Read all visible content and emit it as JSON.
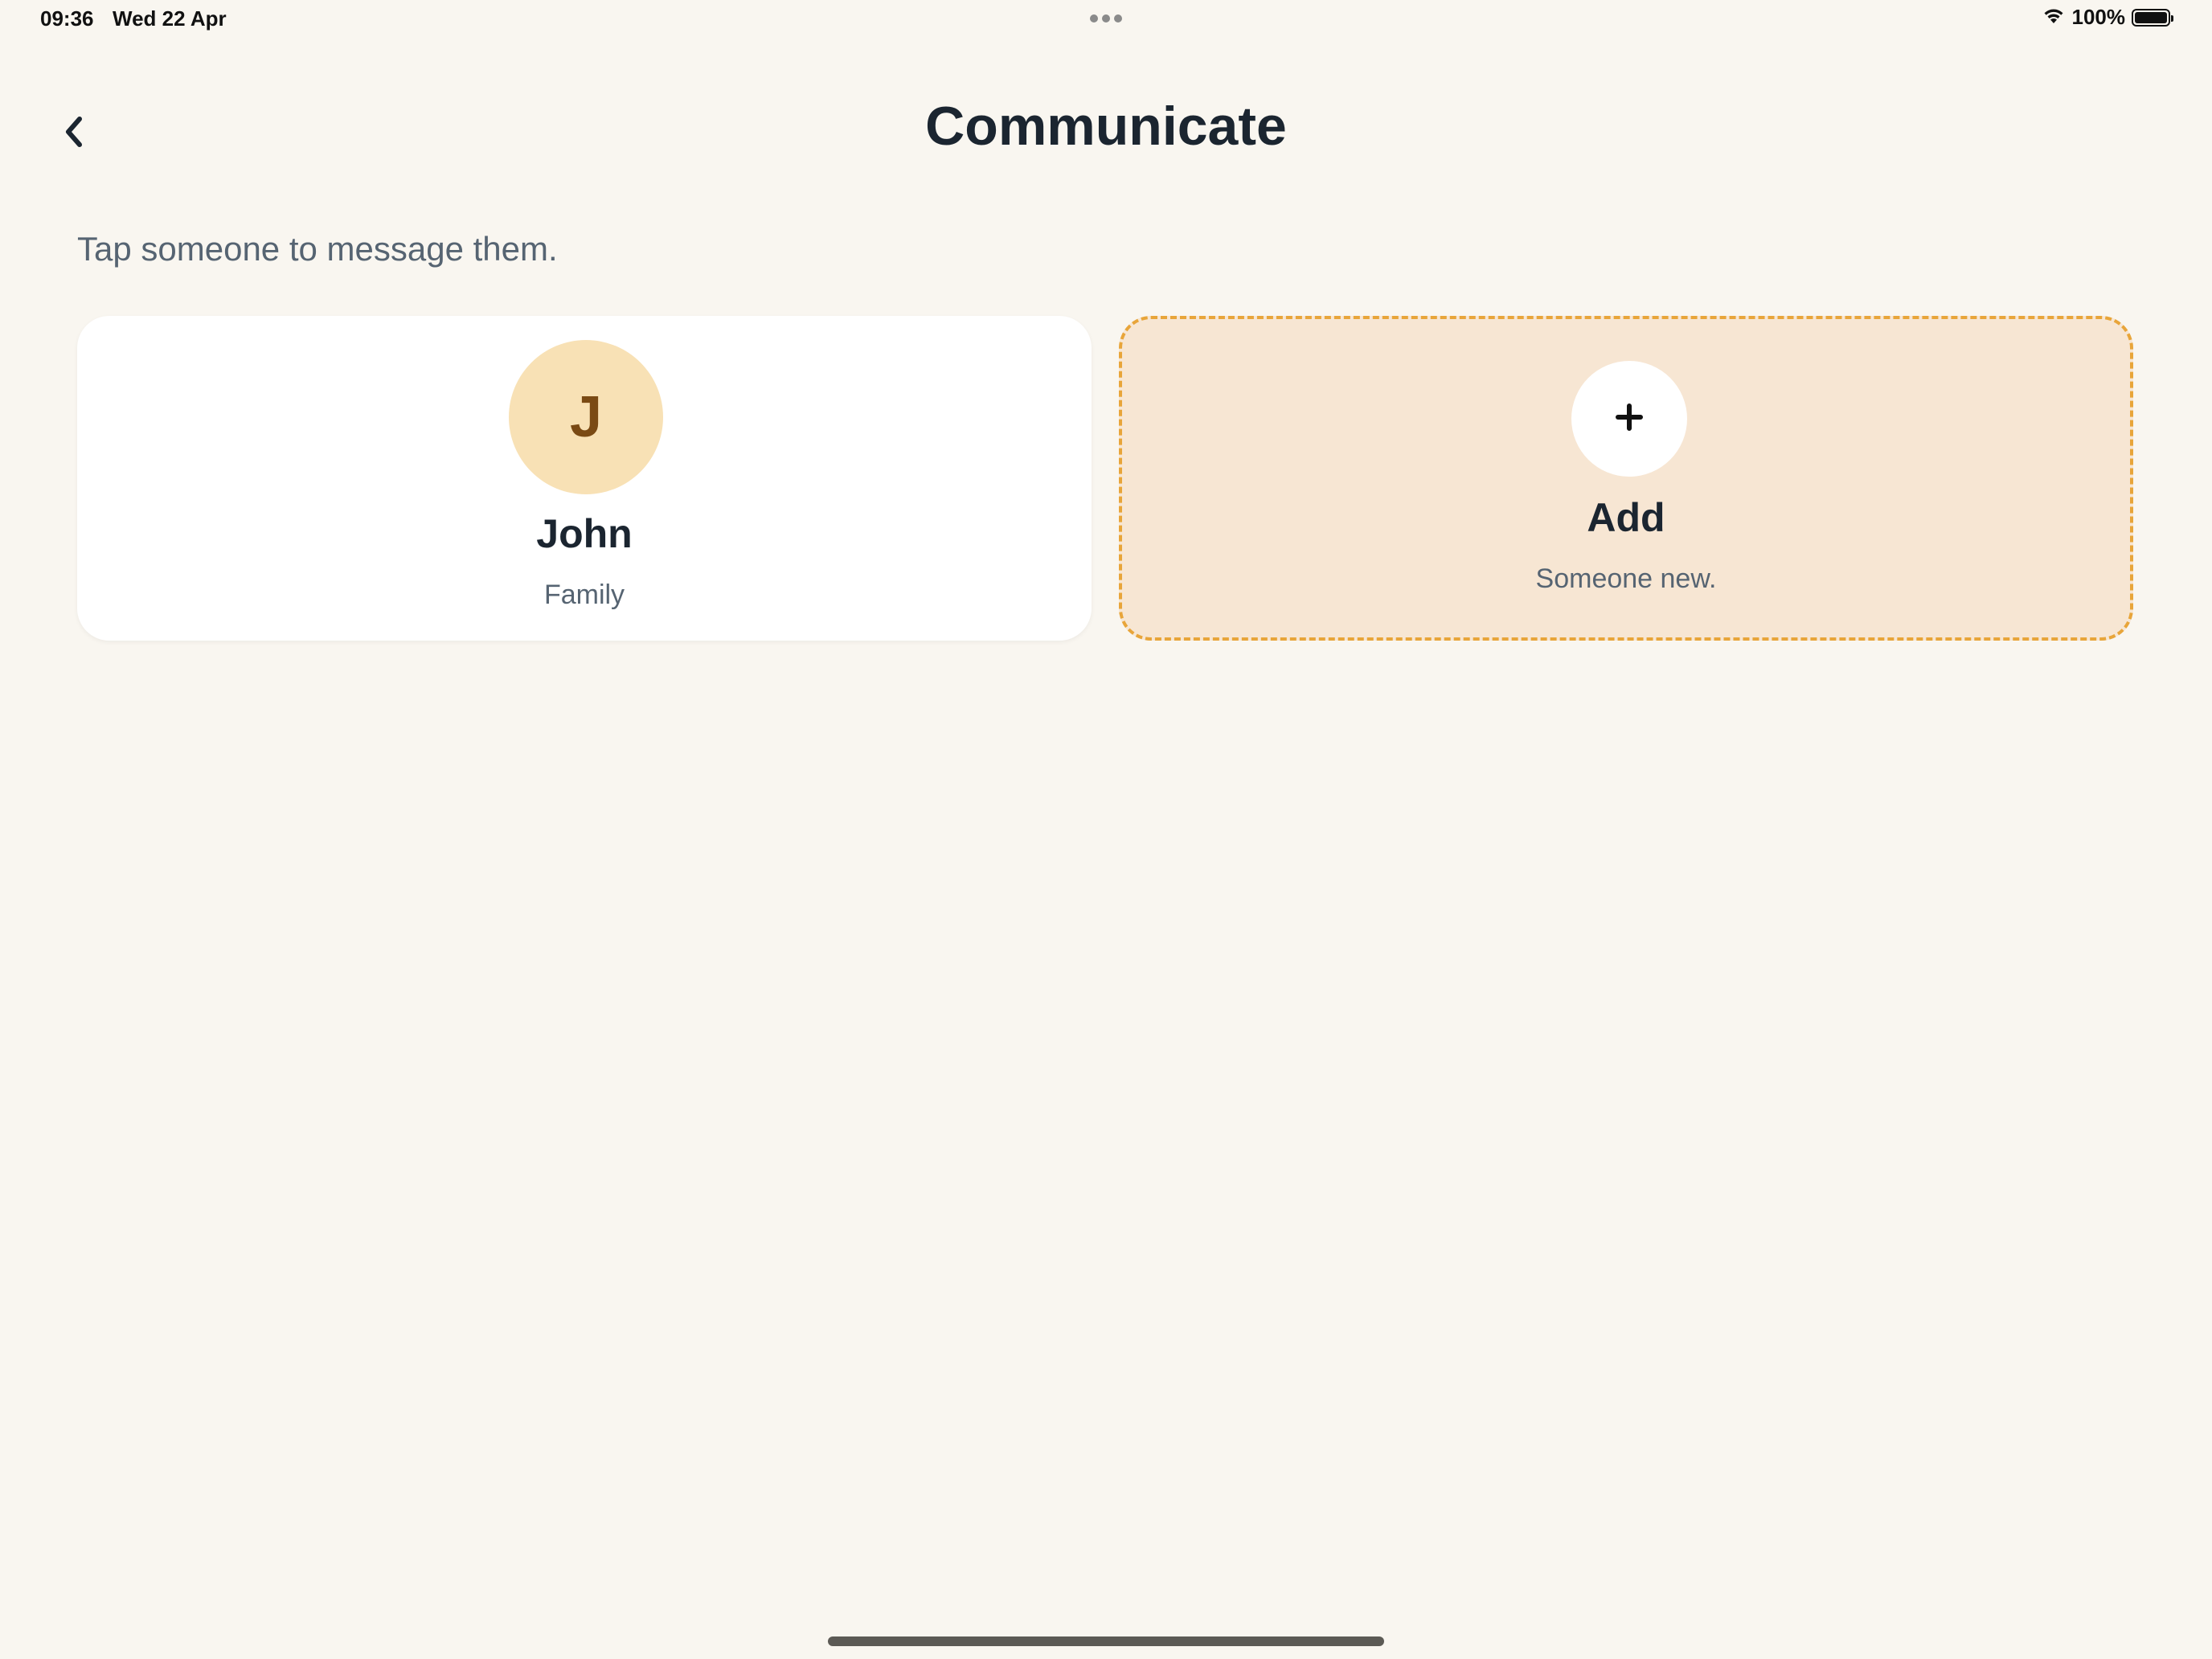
{
  "status_bar": {
    "time": "09:36",
    "date": "Wed 22 Apr",
    "battery_percent": "100%",
    "battery_level": 1.0,
    "icons": [
      "multitasking-dots-icon",
      "wifi-icon",
      "battery-icon"
    ]
  },
  "header": {
    "back_icon": "chevron-left-icon",
    "title": "Communicate"
  },
  "instructions": "Tap someone to message them.",
  "contacts": [
    {
      "initial": "J",
      "name": "John",
      "relation": "Family",
      "avatar_color": "#f8e1b5",
      "initial_color": "#7a4a14"
    }
  ],
  "add_card": {
    "icon": "plus-icon",
    "title": "Add",
    "subtitle": "Someone new.",
    "background": "#f7e6d3",
    "border_color": "#e8a53a"
  },
  "colors": {
    "background": "#f9f6f0",
    "text_primary": "#1b2530",
    "text_secondary": "#566472"
  }
}
